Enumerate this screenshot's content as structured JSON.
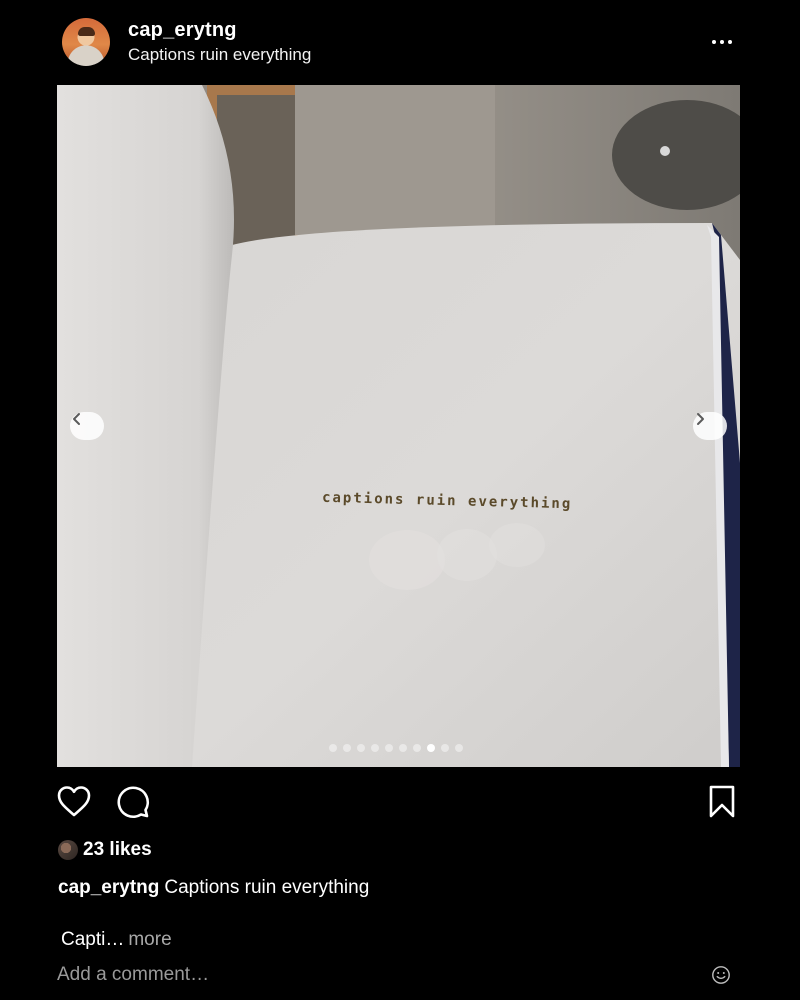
{
  "post": {
    "username": "cap_erytng",
    "subtitle": "Captions ruin everything",
    "more_icon": "more-horizontal-icon"
  },
  "photo": {
    "book_text": "captions ruin everything",
    "prev_icon": "chevron-left-icon",
    "next_icon": "chevron-right-icon",
    "slide_count": 10,
    "active_slide": 8
  },
  "actions": {
    "like_icon": "heart-icon",
    "comment_icon": "comment-icon",
    "save_icon": "bookmark-icon"
  },
  "likes": {
    "text": "23 likes"
  },
  "caption": {
    "username": "cap_erytng",
    "text": "Captions ruin everything"
  },
  "truncated": {
    "text": "Capti…",
    "more_label": "more"
  },
  "comment": {
    "placeholder": "Add a comment…",
    "emoji_icon": "emoji-icon"
  },
  "colors": {
    "background": "#000000",
    "text": "#ffffff",
    "muted": "#a8a8a8"
  }
}
